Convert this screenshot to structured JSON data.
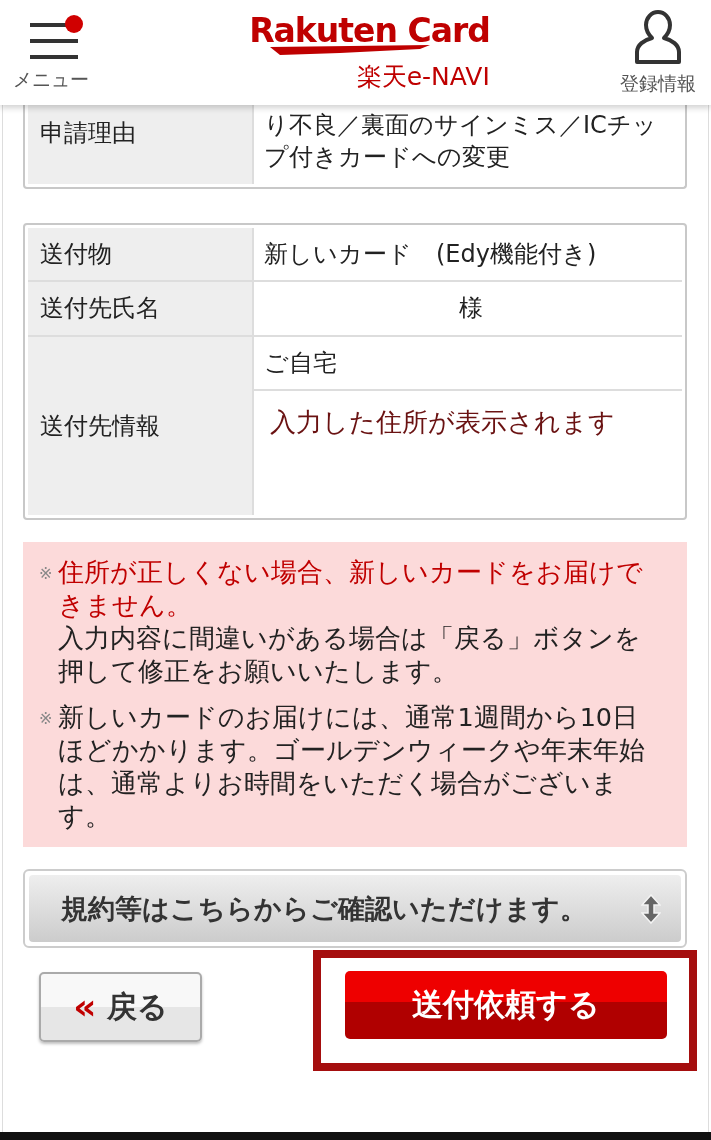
{
  "header": {
    "menu": {
      "label": "メニュー",
      "has_notification": true
    },
    "logo": {
      "brand": "Rakuten Card",
      "service": "楽天e-NAVI"
    },
    "account": {
      "label": "登録情報"
    }
  },
  "reason_table": {
    "rows": [
      {
        "label": "申請理由",
        "values": [
          "り不良／裏面のサインミス／ICチップ付きカードへの変更"
        ]
      }
    ]
  },
  "delivery_table": {
    "rows": [
      {
        "label": "送付物",
        "values": [
          "新しいカード　(Edy機能付き)"
        ]
      },
      {
        "label": "送付先氏名",
        "values": [
          "様"
        ],
        "kind": "name"
      },
      {
        "label": "送付先情報",
        "values": [
          "ご自宅",
          "入力した住所が表示されます"
        ],
        "kind": "address"
      }
    ]
  },
  "notes": [
    {
      "marker": "※",
      "parts": [
        {
          "text": "住所が正しくない場合、新しいカードをお届けできません。",
          "emphasis": true
        },
        {
          "text": "入力内容に間違いがある場合は「戻る」ボタンを押して修正をお願いいたします。",
          "emphasis": false
        }
      ]
    },
    {
      "marker": "※",
      "parts": [
        {
          "text": "新しいカードのお届けには、通常1週間から10日ほどかかります。ゴールデンウィークや年末年始は、通常よりお時間をいただく場合がございます。",
          "emphasis": false
        }
      ]
    }
  ],
  "terms_select": {
    "label": "規約等はこちらからご確認いただけます。"
  },
  "buttons": {
    "back": {
      "label": "戻る",
      "icon": "«"
    },
    "submit": {
      "label": "送付依頼する",
      "highlighted": true
    }
  }
}
